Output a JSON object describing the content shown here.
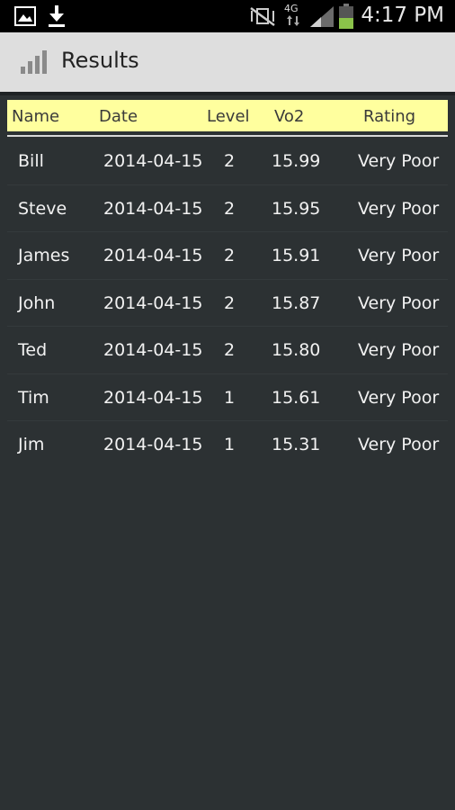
{
  "status_bar": {
    "time": "4:17 PM",
    "network": "4G"
  },
  "action_bar": {
    "title": "Results"
  },
  "table": {
    "columns": [
      "Name",
      "Date",
      "Level",
      "Vo2",
      "Rating"
    ],
    "rows": [
      {
        "name": "Bill",
        "date": "2014-04-15",
        "level": "2",
        "vo2": "15.99",
        "rating": "Very Poor"
      },
      {
        "name": "Steve",
        "date": "2014-04-15",
        "level": "2",
        "vo2": "15.95",
        "rating": "Very Poor"
      },
      {
        "name": "James",
        "date": "2014-04-15",
        "level": "2",
        "vo2": "15.91",
        "rating": "Very Poor"
      },
      {
        "name": "John",
        "date": "2014-04-15",
        "level": "2",
        "vo2": "15.87",
        "rating": "Very Poor"
      },
      {
        "name": "Ted",
        "date": "2014-04-15",
        "level": "2",
        "vo2": "15.80",
        "rating": "Very Poor"
      },
      {
        "name": "Tim",
        "date": "2014-04-15",
        "level": "1",
        "vo2": "15.61",
        "rating": "Very Poor"
      },
      {
        "name": "Jim",
        "date": "2014-04-15",
        "level": "1",
        "vo2": "15.31",
        "rating": "Very Poor"
      }
    ]
  },
  "colors": {
    "header_bg": "#ffff9e",
    "body_bg": "#2c3133",
    "action_bar_bg": "#dedede",
    "battery_green": "#8bc34a"
  }
}
